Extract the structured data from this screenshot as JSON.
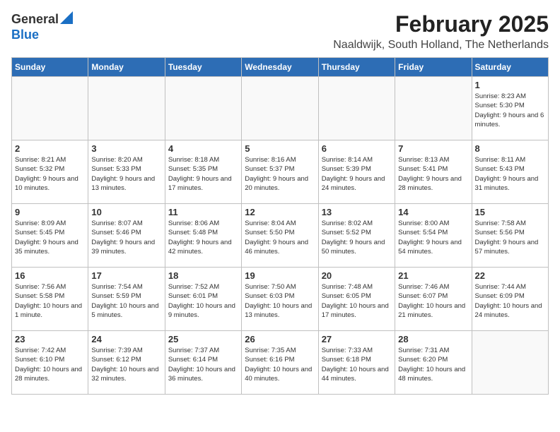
{
  "logo": {
    "general": "General",
    "blue": "Blue"
  },
  "title": "February 2025",
  "subtitle": "Naaldwijk, South Holland, The Netherlands",
  "days_of_week": [
    "Sunday",
    "Monday",
    "Tuesday",
    "Wednesday",
    "Thursday",
    "Friday",
    "Saturday"
  ],
  "weeks": [
    [
      {
        "day": "",
        "info": ""
      },
      {
        "day": "",
        "info": ""
      },
      {
        "day": "",
        "info": ""
      },
      {
        "day": "",
        "info": ""
      },
      {
        "day": "",
        "info": ""
      },
      {
        "day": "",
        "info": ""
      },
      {
        "day": "1",
        "info": "Sunrise: 8:23 AM\nSunset: 5:30 PM\nDaylight: 9 hours and 6 minutes."
      }
    ],
    [
      {
        "day": "2",
        "info": "Sunrise: 8:21 AM\nSunset: 5:32 PM\nDaylight: 9 hours and 10 minutes."
      },
      {
        "day": "3",
        "info": "Sunrise: 8:20 AM\nSunset: 5:33 PM\nDaylight: 9 hours and 13 minutes."
      },
      {
        "day": "4",
        "info": "Sunrise: 8:18 AM\nSunset: 5:35 PM\nDaylight: 9 hours and 17 minutes."
      },
      {
        "day": "5",
        "info": "Sunrise: 8:16 AM\nSunset: 5:37 PM\nDaylight: 9 hours and 20 minutes."
      },
      {
        "day": "6",
        "info": "Sunrise: 8:14 AM\nSunset: 5:39 PM\nDaylight: 9 hours and 24 minutes."
      },
      {
        "day": "7",
        "info": "Sunrise: 8:13 AM\nSunset: 5:41 PM\nDaylight: 9 hours and 28 minutes."
      },
      {
        "day": "8",
        "info": "Sunrise: 8:11 AM\nSunset: 5:43 PM\nDaylight: 9 hours and 31 minutes."
      }
    ],
    [
      {
        "day": "9",
        "info": "Sunrise: 8:09 AM\nSunset: 5:45 PM\nDaylight: 9 hours and 35 minutes."
      },
      {
        "day": "10",
        "info": "Sunrise: 8:07 AM\nSunset: 5:46 PM\nDaylight: 9 hours and 39 minutes."
      },
      {
        "day": "11",
        "info": "Sunrise: 8:06 AM\nSunset: 5:48 PM\nDaylight: 9 hours and 42 minutes."
      },
      {
        "day": "12",
        "info": "Sunrise: 8:04 AM\nSunset: 5:50 PM\nDaylight: 9 hours and 46 minutes."
      },
      {
        "day": "13",
        "info": "Sunrise: 8:02 AM\nSunset: 5:52 PM\nDaylight: 9 hours and 50 minutes."
      },
      {
        "day": "14",
        "info": "Sunrise: 8:00 AM\nSunset: 5:54 PM\nDaylight: 9 hours and 54 minutes."
      },
      {
        "day": "15",
        "info": "Sunrise: 7:58 AM\nSunset: 5:56 PM\nDaylight: 9 hours and 57 minutes."
      }
    ],
    [
      {
        "day": "16",
        "info": "Sunrise: 7:56 AM\nSunset: 5:58 PM\nDaylight: 10 hours and 1 minute."
      },
      {
        "day": "17",
        "info": "Sunrise: 7:54 AM\nSunset: 5:59 PM\nDaylight: 10 hours and 5 minutes."
      },
      {
        "day": "18",
        "info": "Sunrise: 7:52 AM\nSunset: 6:01 PM\nDaylight: 10 hours and 9 minutes."
      },
      {
        "day": "19",
        "info": "Sunrise: 7:50 AM\nSunset: 6:03 PM\nDaylight: 10 hours and 13 minutes."
      },
      {
        "day": "20",
        "info": "Sunrise: 7:48 AM\nSunset: 6:05 PM\nDaylight: 10 hours and 17 minutes."
      },
      {
        "day": "21",
        "info": "Sunrise: 7:46 AM\nSunset: 6:07 PM\nDaylight: 10 hours and 21 minutes."
      },
      {
        "day": "22",
        "info": "Sunrise: 7:44 AM\nSunset: 6:09 PM\nDaylight: 10 hours and 24 minutes."
      }
    ],
    [
      {
        "day": "23",
        "info": "Sunrise: 7:42 AM\nSunset: 6:10 PM\nDaylight: 10 hours and 28 minutes."
      },
      {
        "day": "24",
        "info": "Sunrise: 7:39 AM\nSunset: 6:12 PM\nDaylight: 10 hours and 32 minutes."
      },
      {
        "day": "25",
        "info": "Sunrise: 7:37 AM\nSunset: 6:14 PM\nDaylight: 10 hours and 36 minutes."
      },
      {
        "day": "26",
        "info": "Sunrise: 7:35 AM\nSunset: 6:16 PM\nDaylight: 10 hours and 40 minutes."
      },
      {
        "day": "27",
        "info": "Sunrise: 7:33 AM\nSunset: 6:18 PM\nDaylight: 10 hours and 44 minutes."
      },
      {
        "day": "28",
        "info": "Sunrise: 7:31 AM\nSunset: 6:20 PM\nDaylight: 10 hours and 48 minutes."
      },
      {
        "day": "",
        "info": ""
      }
    ]
  ]
}
